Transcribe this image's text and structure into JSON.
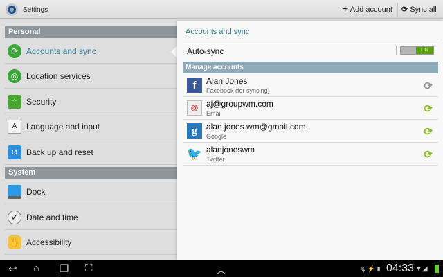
{
  "topbar": {
    "title": "Settings",
    "add_account": "Add account",
    "sync_all": "Sync all"
  },
  "sidebar": {
    "personal": "Personal",
    "system": "System",
    "items": [
      {
        "label": "Accounts and sync",
        "icon": "sync-icon"
      },
      {
        "label": "Location services",
        "icon": "location-icon"
      },
      {
        "label": "Security",
        "icon": "security-grid-icon"
      },
      {
        "label": "Language and input",
        "icon": "language-icon"
      },
      {
        "label": "Back up and reset",
        "icon": "backup-icon"
      },
      {
        "label": "Dock",
        "icon": "dock-icon"
      },
      {
        "label": "Date and time",
        "icon": "clock-icon"
      },
      {
        "label": "Accessibility",
        "icon": "hand-icon"
      }
    ]
  },
  "main": {
    "title": "Accounts and sync",
    "autosync_label": "Auto-sync",
    "autosync_state": "ON",
    "manage_header": "Manage accounts",
    "accounts": [
      {
        "name": "Alan Jones",
        "type": "Facebook (for syncing)",
        "sync_color": "#9a9a9a"
      },
      {
        "name": "aj@groupwm.com",
        "type": "Email",
        "sync_color": "#8cc21e"
      },
      {
        "name": "alan.jones.wm@gmail.com",
        "type": "Google",
        "sync_color": "#8cc21e"
      },
      {
        "name": "alanjoneswm",
        "type": "Twitter",
        "sync_color": "#8cc21e"
      }
    ]
  },
  "statusbar": {
    "time": "04:33"
  },
  "colors": {
    "accent": "#2a7b94",
    "switch_on": "#5aa00c",
    "manage_header": "#8faabb"
  }
}
